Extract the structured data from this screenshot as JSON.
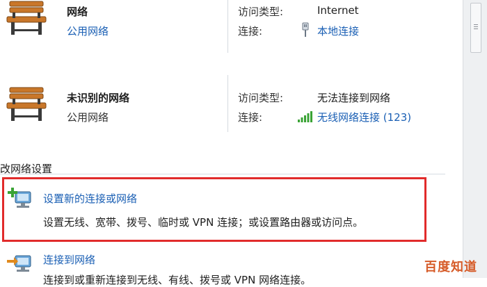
{
  "networks": [
    {
      "name": "网络",
      "category": "公用网络",
      "access_type_label": "访问类型:",
      "access_type_value": "Internet",
      "connection_label": "连接:",
      "connection_value": "本地连接"
    },
    {
      "name": "未识别的网络",
      "category": "公用网络",
      "access_type_label": "访问类型:",
      "access_type_value": "无法连接到网络",
      "connection_label": "连接:",
      "connection_value": "无线网络连接 (123)"
    }
  ],
  "section": {
    "title": "改网络设置"
  },
  "tasks": [
    {
      "title": "设置新的连接或网络",
      "description": "设置无线、宽带、拨号、临时或 VPN 连接；或设置路由器或访问点。"
    },
    {
      "title": "连接到网络",
      "description": "连接到或重新连接到无线、有线、拨号或 VPN 网络连接。"
    }
  ],
  "watermark": "百度知道",
  "colors": {
    "link": "#1a5fb4",
    "highlight": "#e12b2b",
    "signal": "#3aa335"
  }
}
